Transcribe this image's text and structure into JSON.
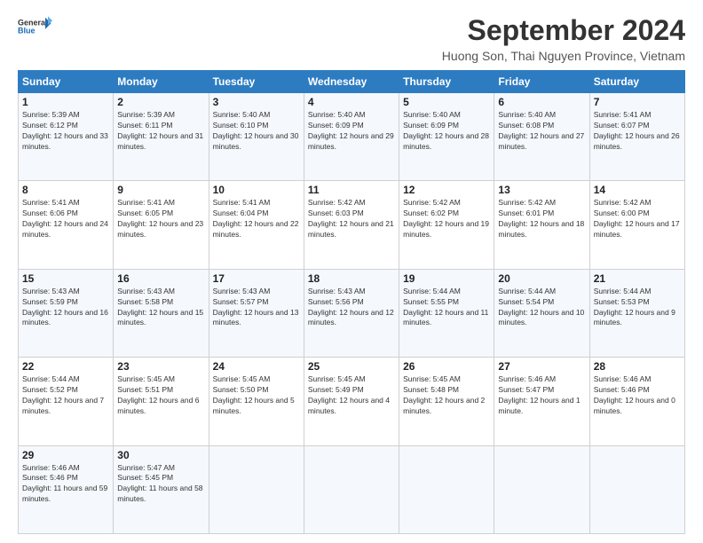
{
  "logo": {
    "line1": "General",
    "line2": "Blue"
  },
  "header": {
    "month": "September 2024",
    "location": "Huong Son, Thai Nguyen Province, Vietnam"
  },
  "weekdays": [
    "Sunday",
    "Monday",
    "Tuesday",
    "Wednesday",
    "Thursday",
    "Friday",
    "Saturday"
  ],
  "weeks": [
    [
      {
        "day": "1",
        "sunrise": "5:39 AM",
        "sunset": "6:12 PM",
        "daylight": "12 hours and 33 minutes."
      },
      {
        "day": "2",
        "sunrise": "5:39 AM",
        "sunset": "6:11 PM",
        "daylight": "12 hours and 31 minutes."
      },
      {
        "day": "3",
        "sunrise": "5:40 AM",
        "sunset": "6:10 PM",
        "daylight": "12 hours and 30 minutes."
      },
      {
        "day": "4",
        "sunrise": "5:40 AM",
        "sunset": "6:09 PM",
        "daylight": "12 hours and 29 minutes."
      },
      {
        "day": "5",
        "sunrise": "5:40 AM",
        "sunset": "6:09 PM",
        "daylight": "12 hours and 28 minutes."
      },
      {
        "day": "6",
        "sunrise": "5:40 AM",
        "sunset": "6:08 PM",
        "daylight": "12 hours and 27 minutes."
      },
      {
        "day": "7",
        "sunrise": "5:41 AM",
        "sunset": "6:07 PM",
        "daylight": "12 hours and 26 minutes."
      }
    ],
    [
      {
        "day": "8",
        "sunrise": "5:41 AM",
        "sunset": "6:06 PM",
        "daylight": "12 hours and 24 minutes."
      },
      {
        "day": "9",
        "sunrise": "5:41 AM",
        "sunset": "6:05 PM",
        "daylight": "12 hours and 23 minutes."
      },
      {
        "day": "10",
        "sunrise": "5:41 AM",
        "sunset": "6:04 PM",
        "daylight": "12 hours and 22 minutes."
      },
      {
        "day": "11",
        "sunrise": "5:42 AM",
        "sunset": "6:03 PM",
        "daylight": "12 hours and 21 minutes."
      },
      {
        "day": "12",
        "sunrise": "5:42 AM",
        "sunset": "6:02 PM",
        "daylight": "12 hours and 19 minutes."
      },
      {
        "day": "13",
        "sunrise": "5:42 AM",
        "sunset": "6:01 PM",
        "daylight": "12 hours and 18 minutes."
      },
      {
        "day": "14",
        "sunrise": "5:42 AM",
        "sunset": "6:00 PM",
        "daylight": "12 hours and 17 minutes."
      }
    ],
    [
      {
        "day": "15",
        "sunrise": "5:43 AM",
        "sunset": "5:59 PM",
        "daylight": "12 hours and 16 minutes."
      },
      {
        "day": "16",
        "sunrise": "5:43 AM",
        "sunset": "5:58 PM",
        "daylight": "12 hours and 15 minutes."
      },
      {
        "day": "17",
        "sunrise": "5:43 AM",
        "sunset": "5:57 PM",
        "daylight": "12 hours and 13 minutes."
      },
      {
        "day": "18",
        "sunrise": "5:43 AM",
        "sunset": "5:56 PM",
        "daylight": "12 hours and 12 minutes."
      },
      {
        "day": "19",
        "sunrise": "5:44 AM",
        "sunset": "5:55 PM",
        "daylight": "12 hours and 11 minutes."
      },
      {
        "day": "20",
        "sunrise": "5:44 AM",
        "sunset": "5:54 PM",
        "daylight": "12 hours and 10 minutes."
      },
      {
        "day": "21",
        "sunrise": "5:44 AM",
        "sunset": "5:53 PM",
        "daylight": "12 hours and 9 minutes."
      }
    ],
    [
      {
        "day": "22",
        "sunrise": "5:44 AM",
        "sunset": "5:52 PM",
        "daylight": "12 hours and 7 minutes."
      },
      {
        "day": "23",
        "sunrise": "5:45 AM",
        "sunset": "5:51 PM",
        "daylight": "12 hours and 6 minutes."
      },
      {
        "day": "24",
        "sunrise": "5:45 AM",
        "sunset": "5:50 PM",
        "daylight": "12 hours and 5 minutes."
      },
      {
        "day": "25",
        "sunrise": "5:45 AM",
        "sunset": "5:49 PM",
        "daylight": "12 hours and 4 minutes."
      },
      {
        "day": "26",
        "sunrise": "5:45 AM",
        "sunset": "5:48 PM",
        "daylight": "12 hours and 2 minutes."
      },
      {
        "day": "27",
        "sunrise": "5:46 AM",
        "sunset": "5:47 PM",
        "daylight": "12 hours and 1 minute."
      },
      {
        "day": "28",
        "sunrise": "5:46 AM",
        "sunset": "5:46 PM",
        "daylight": "12 hours and 0 minutes."
      }
    ],
    [
      {
        "day": "29",
        "sunrise": "5:46 AM",
        "sunset": "5:46 PM",
        "daylight": "11 hours and 59 minutes."
      },
      {
        "day": "30",
        "sunrise": "5:47 AM",
        "sunset": "5:45 PM",
        "daylight": "11 hours and 58 minutes."
      },
      null,
      null,
      null,
      null,
      null
    ]
  ]
}
